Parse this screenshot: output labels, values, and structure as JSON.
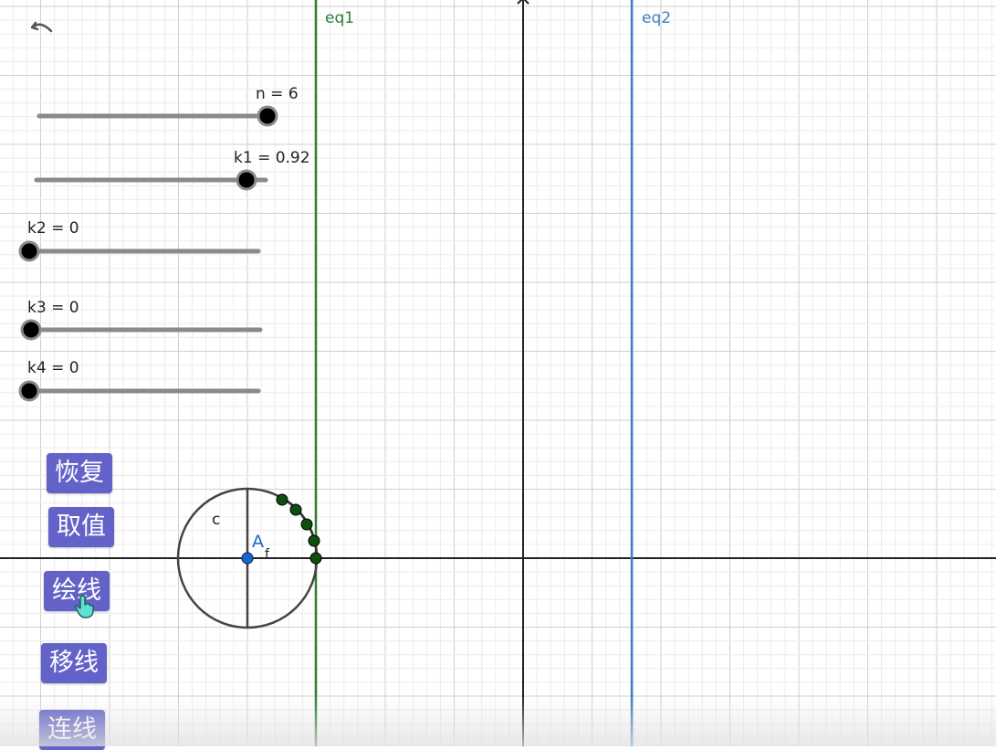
{
  "lines": [
    {
      "id": "eq1",
      "label": "eq1",
      "color": "#2f7d32"
    },
    {
      "id": "eq2",
      "label": "eq2",
      "color": "#3b7fc4"
    }
  ],
  "sliders": [
    {
      "name": "n",
      "label": "n = 6",
      "value": 6,
      "min": 1,
      "max": 6
    },
    {
      "name": "k1",
      "label": "k1 = 0.92",
      "value": 0.92,
      "min": 0,
      "max": 1
    },
    {
      "name": "k2",
      "label": "k2 = 0",
      "value": 0,
      "min": 0,
      "max": 1
    },
    {
      "name": "k3",
      "label": "k3 = 0",
      "value": 0,
      "min": 0,
      "max": 1
    },
    {
      "name": "k4",
      "label": "k4 = 0",
      "value": 0,
      "min": 0,
      "max": 1
    }
  ],
  "circle": {
    "label": "c",
    "center_label": "A",
    "center_sub": "f"
  },
  "buttons": {
    "reset": "恢复",
    "take_value": "取值",
    "draw_line": "绘线",
    "move_line": "移线",
    "connect_line": "连线"
  },
  "colors": {
    "button": "#6262c8",
    "point": "#0d4f0d",
    "center_point": "#1a66cc",
    "axis": "#222222",
    "grid_minor": "#ececec",
    "grid_major": "#cfcfcf"
  },
  "icons": {
    "undo": "undo-icon",
    "cursor": "hand-pointer-icon"
  }
}
